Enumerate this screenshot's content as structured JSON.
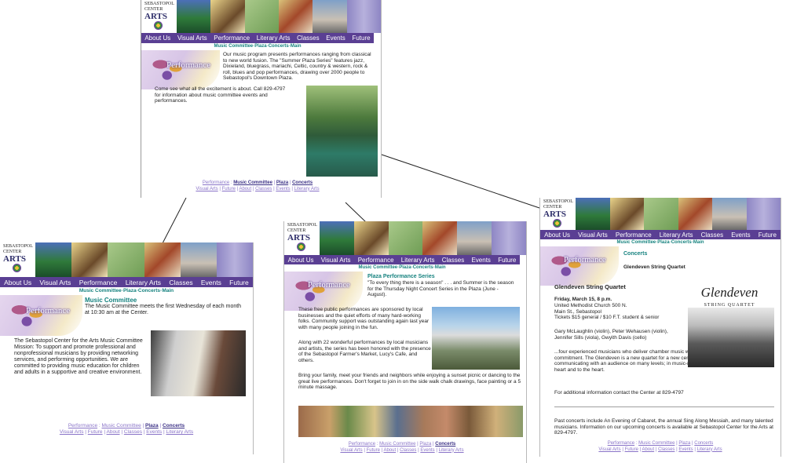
{
  "logo": {
    "top": "SEBASTOPOL",
    "mid": "CENTER",
    "for": "for the",
    "arts": "ARTS"
  },
  "nav": [
    "About Us",
    "Visual Arts",
    "Performance",
    "Literary Arts",
    "Classes",
    "Events",
    "Future"
  ],
  "subnav": "Music Committee◦Plaza◦Concerts◦Main",
  "header_title": "Performance",
  "footer": {
    "row1": [
      "Performance",
      "Music Committee",
      "Plaza",
      "Concerts"
    ],
    "row2": [
      "Visual Arts",
      "Future",
      "About",
      "Classes",
      "Events",
      "Literary Arts"
    ]
  },
  "pages": {
    "main": {
      "p1": "Our music program presents performances ranging from classical to new world fusion. The \"Summer Plaza Series\" features jazz, Dixieland, bluegrass, mariachi, Celtic, country & western, rock & roll, blues and pop performances, drawing over 2000 people to Sebastopol's Downtown Plaza.",
      "p2": "Come see what all the excitement is about. Call 829-4797 for information about music committee events and performances."
    },
    "committee": {
      "heading": "Music Committee",
      "p1": "The Music Committee meets the first Wednesday of each month at 10:30 am at the Center.",
      "p2": "The Sebastopol Center for the Arts Music Committee Mission: To support and promote professional and nonprofessional musicians by providing networking services, and performing opportunities. We are committed to providing music education for children and adults in a supportive and creative environment."
    },
    "plaza": {
      "heading": "Plaza Performance Series",
      "intro": "\"To every thing there is a season\" . . . and Summer is the season for the Thursday Night Concert Series in the Plaza (June - August).",
      "p1": "These free public performances are sponsored by local businesses and the quiet efforts of many hard-working folks. Community support was outstanding again last year with many people joining in the fun.",
      "p2": "Along with 22 wonderful performances by local musicians and artists, the series has been honored with the presence of the Sebastopol Farmer's Market, Lucy's Cafe, and others.",
      "p3": "Bring your family, meet your friends and neighbors while enjoying a sunset picnic or dancing to the great live performances. Don't forget to join in on the side walk chalk drawings, face painting or a 5 minute massage."
    },
    "concerts": {
      "heading": "Concerts",
      "subheading": "Glendeven String Quartet",
      "title": "Glendeven String Quartet",
      "logo_name": "Glendeven",
      "logo_sub": "STRING QUARTET",
      "date": "Friday, March 15, 8 p.m.",
      "venue": "United Methodist Church 500 N. Main St., Sebastopol",
      "tickets": "Tickets $15 general / $10 F.T. student & senior",
      "players": "Gary McLaughlin (violin), Peter Wehausen (violin), Jennifer Sills (viola), Gwyith Davis (cello)",
      "p1": "...four experienced musicians who deliver chamber music with grace, power, and commitment. The Glendeven is a new quartet for a new century- one that believes in communicating with an audience on many levels; in music-making that speaks from the heart and to the heart.",
      "p2": "For additional information contact the Center at 829-4797",
      "p3": "Past concerts include An Evening of Cabaret, the annual Sing Along Messiah, and many talented musicians. Information on our upcoming concerts is available at Sebastopol Center for the Arts at 829-4797."
    }
  },
  "colors": {
    "nav": "#5a3f93",
    "teal": "#16827f",
    "link": "#8a74c8"
  }
}
